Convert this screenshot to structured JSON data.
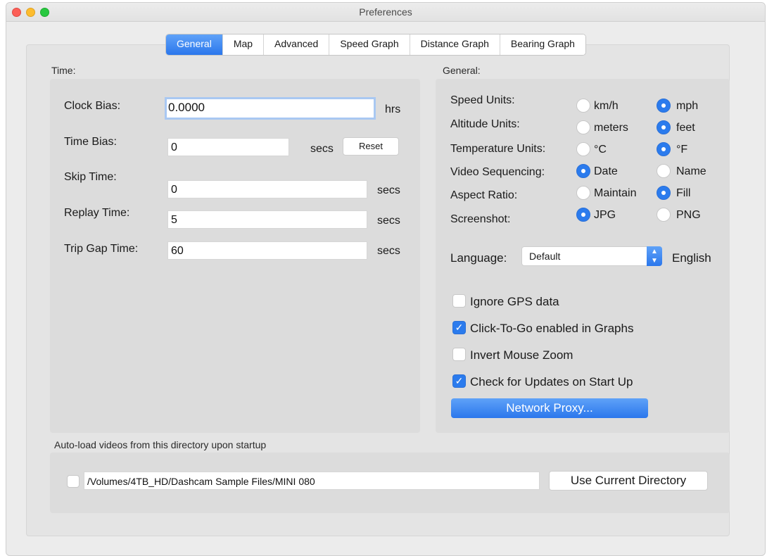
{
  "window": {
    "title": "Preferences"
  },
  "tabs": [
    "General",
    "Map",
    "Advanced",
    "Speed Graph",
    "Distance Graph",
    "Bearing Graph"
  ],
  "time": {
    "section_label": "Time:",
    "clock_bias": {
      "label": "Clock Bias:",
      "value": "0.0000",
      "unit": "hrs"
    },
    "time_bias": {
      "label": "Time Bias:",
      "value": "0",
      "unit": "secs",
      "reset": "Reset"
    },
    "skip_time": {
      "label": "Skip Time:",
      "value": "0",
      "unit": "secs"
    },
    "replay_time": {
      "label": "Replay Time:",
      "value": "5",
      "unit": "secs"
    },
    "trip_gap_time": {
      "label": "Trip Gap Time:",
      "value": "60",
      "unit": "secs"
    }
  },
  "general": {
    "section_label": "General:",
    "speed_units": {
      "label": "Speed Units:",
      "opt1": "km/h",
      "opt2": "mph",
      "selected": "mph"
    },
    "altitude_units": {
      "label": "Altitude Units:",
      "opt1": "meters",
      "opt2": "feet",
      "selected": "feet"
    },
    "temperature_units": {
      "label": "Temperature Units:",
      "opt1": "°C",
      "opt2": "°F",
      "selected": "°F"
    },
    "video_sequencing": {
      "label": "Video Sequencing:",
      "opt1": "Date",
      "opt2": "Name",
      "selected": "Date"
    },
    "aspect_ratio": {
      "label": "Aspect Ratio:",
      "opt1": "Maintain",
      "opt2": "Fill",
      "selected": "Fill"
    },
    "screenshot": {
      "label": "Screenshot:",
      "opt1": "JPG",
      "opt2": "PNG",
      "selected": "JPG"
    },
    "language": {
      "label": "Language:",
      "value": "Default",
      "display": "English"
    },
    "ignore_gps": {
      "label": "Ignore GPS data",
      "checked": false
    },
    "click_to_go": {
      "label": "Click-To-Go enabled in Graphs",
      "checked": true
    },
    "invert_zoom": {
      "label": "Invert Mouse Zoom",
      "checked": false
    },
    "check_updates": {
      "label": "Check for Updates on Start Up",
      "checked": true
    },
    "network_proxy": "Network Proxy..."
  },
  "autoload": {
    "section_label": "Auto-load videos from this directory upon startup",
    "checked": false,
    "path": "/Volumes/4TB_HD/Dashcam Sample Files/MINI 080",
    "button": "Use Current Directory"
  },
  "colors": {
    "accent": "#2b7bed",
    "panel": "#dcdcdc",
    "window": "#ececec"
  }
}
